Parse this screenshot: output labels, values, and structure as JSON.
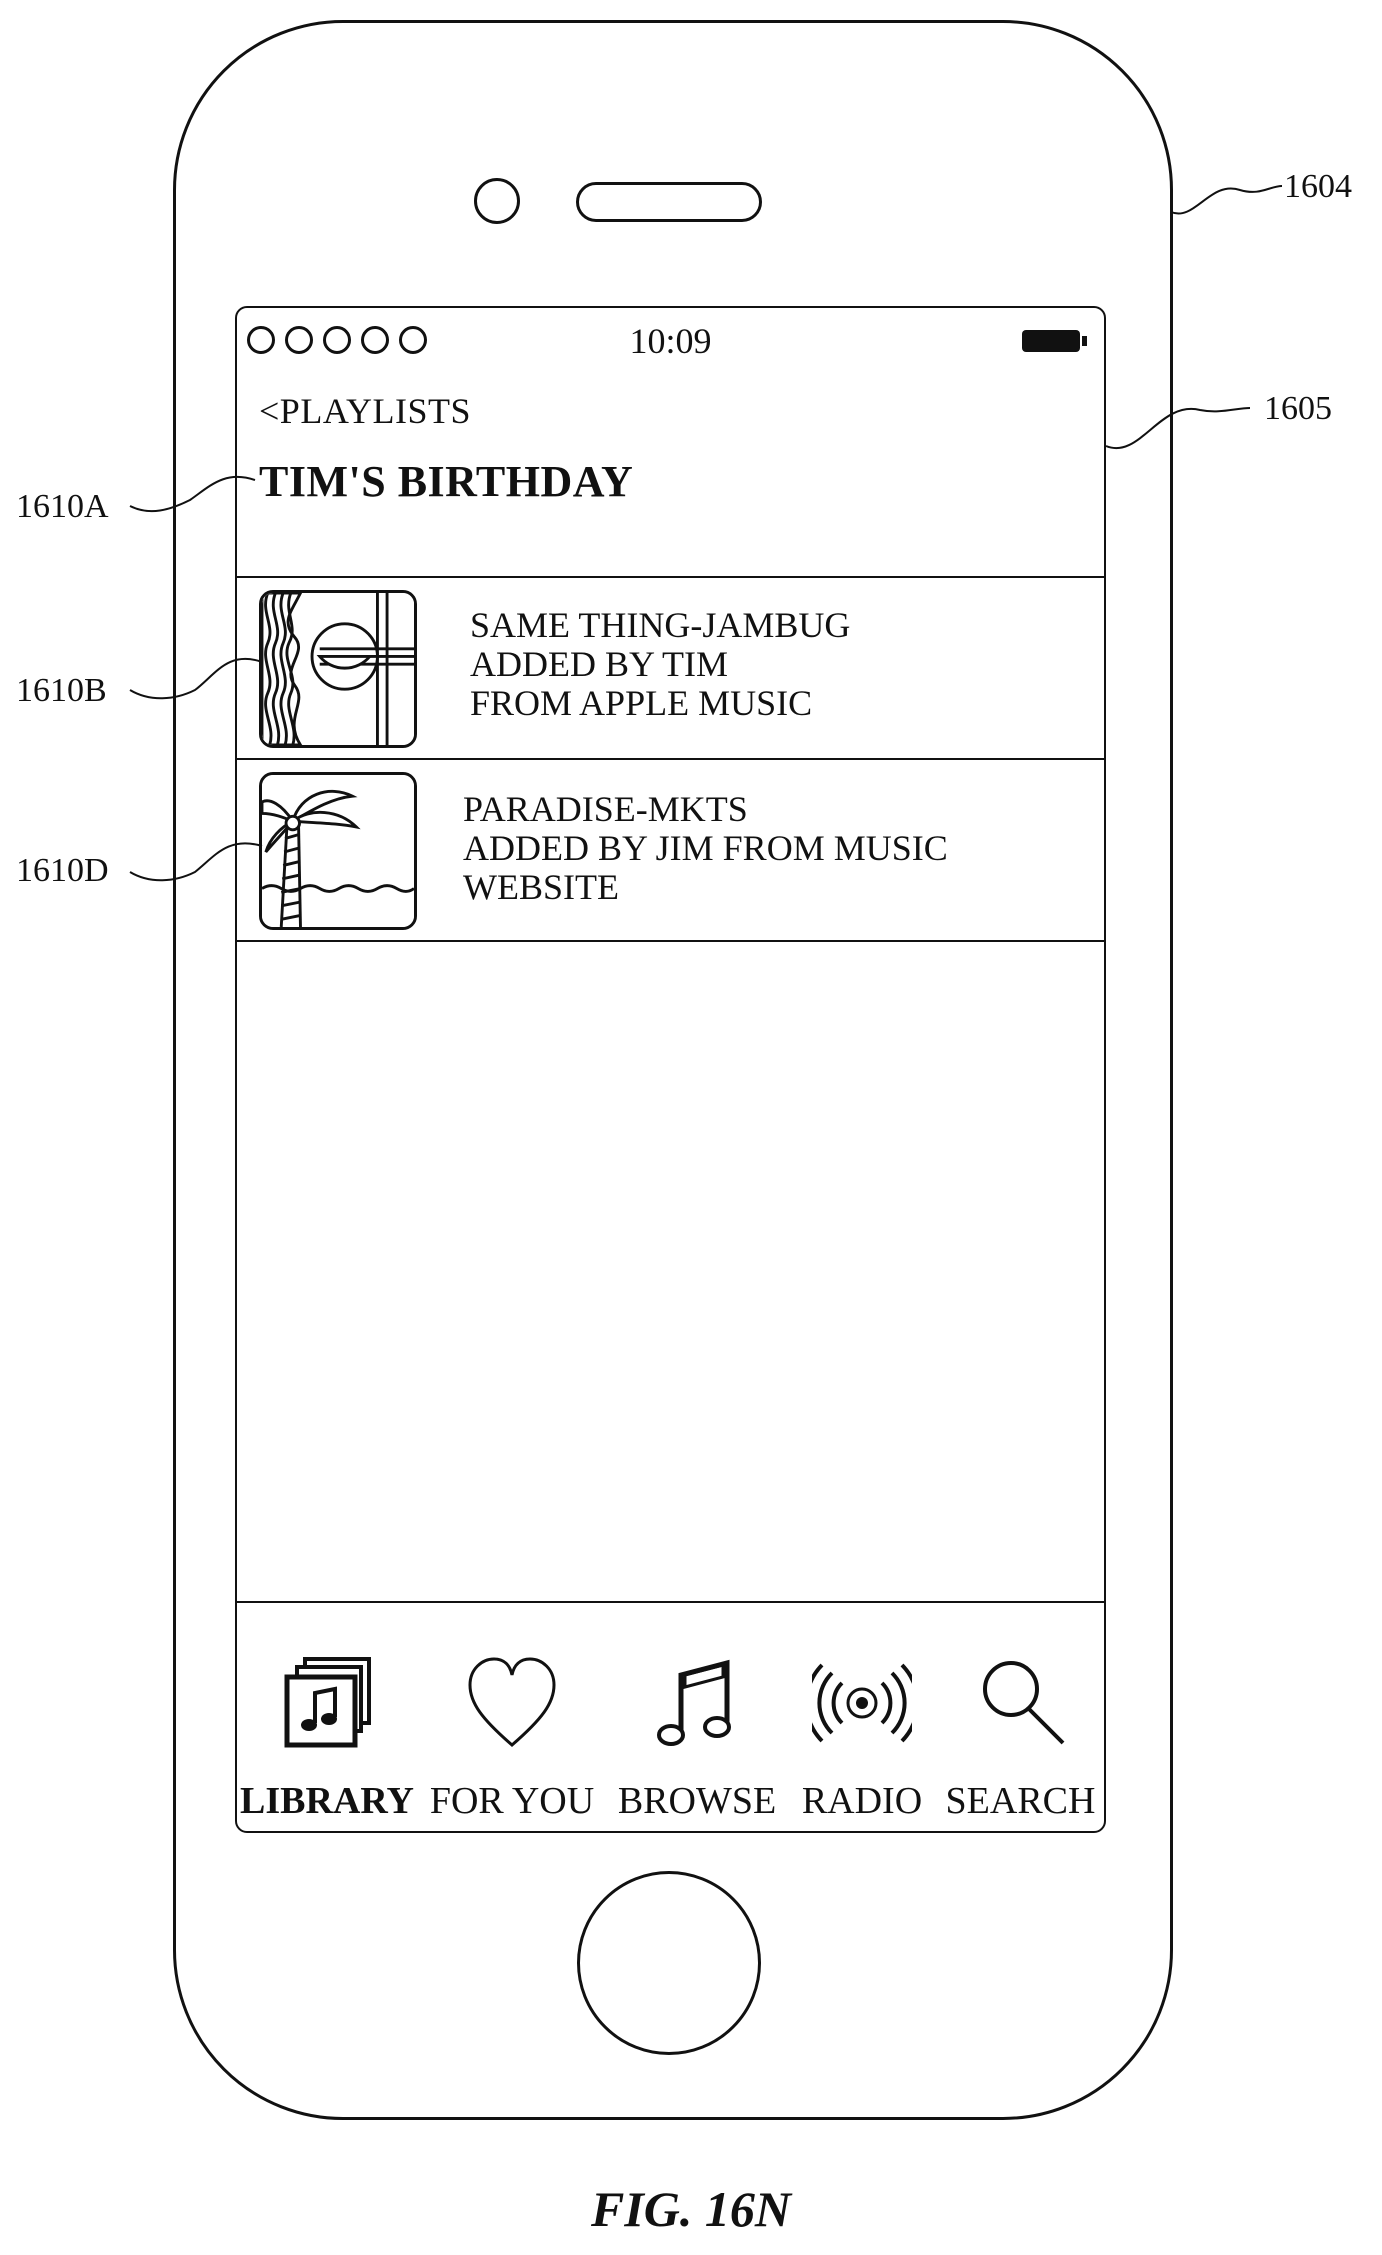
{
  "status_bar": {
    "time": "10:09",
    "signal_dots": 5,
    "battery_level": 1.0
  },
  "nav": {
    "back_label": "<PLAYLISTS"
  },
  "playlist": {
    "title": "TIM'S BIRTHDAY"
  },
  "songs": [
    {
      "lines": [
        "SAME THING-JAMBUG",
        "ADDED BY TIM",
        "FROM APPLE MUSIC"
      ],
      "artwork": "sunset-waves-art"
    },
    {
      "lines": [
        "PARADISE-MKTS",
        "ADDED BY JIM FROM MUSIC",
        "WEBSITE"
      ],
      "artwork": "palm-tree-art"
    }
  ],
  "tabs": [
    {
      "label": "LIBRARY",
      "icon": "library-icon",
      "active": true
    },
    {
      "label": "FOR YOU",
      "icon": "heart-icon",
      "active": false
    },
    {
      "label": "BROWSE",
      "icon": "music-note-icon",
      "active": false
    },
    {
      "label": "RADIO",
      "icon": "radio-icon",
      "active": false
    },
    {
      "label": "SEARCH",
      "icon": "search-icon",
      "active": false
    }
  ],
  "callouts": {
    "device": "1604",
    "screen": "1605",
    "title": "1610A",
    "song_1": "1610B",
    "song_2": "1610D"
  },
  "figure_caption": "FIG. 16N"
}
